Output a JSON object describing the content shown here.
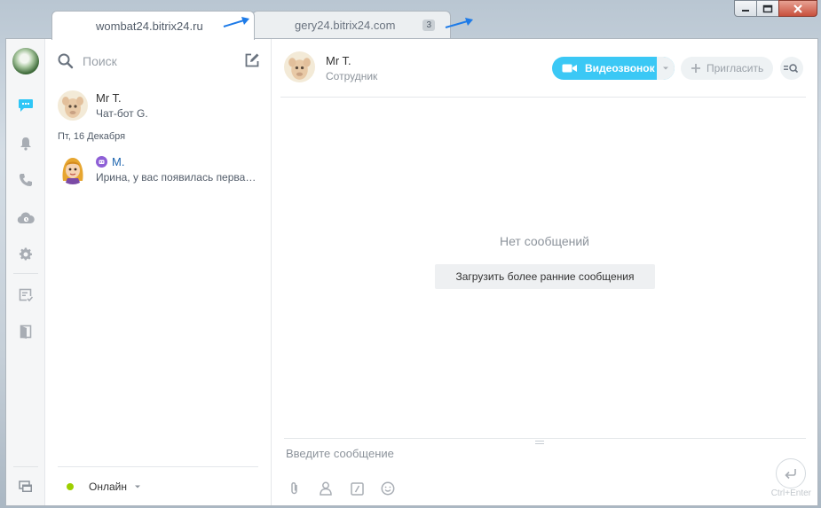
{
  "tabs": [
    {
      "label": "wombat24.bitrix24.ru",
      "count": ""
    },
    {
      "label": "gery24.bitrix24.com",
      "count": "3"
    }
  ],
  "search": {
    "placeholder": "Поиск"
  },
  "recent": {
    "items": [
      {
        "name": "Mr T.",
        "sub": "Чат-бот G."
      },
      {
        "name": "M.",
        "sub": "Ирина, у вас появилась первая задача!"
      }
    ],
    "date_header": "Пт, 16 Декабря"
  },
  "status": {
    "label": "Онлайн",
    "color": "#9dcf00"
  },
  "chat": {
    "name": "Mr T.",
    "position": "Сотрудник",
    "video_label": "Видеозвонок",
    "invite_label": "Пригласить",
    "empty_text": "Нет сообщений",
    "load_label": "Загрузить более ранние сообщения",
    "input_placeholder": "Введите сообщение",
    "send_hint": "Ctrl+Enter"
  },
  "colors": {
    "accent": "#3bc8f5",
    "arrow": "#1e7be8"
  },
  "icons": [
    "chat-icon",
    "bell-icon",
    "phone-icon",
    "cloud-icon",
    "gear-icon",
    "tasks-icon",
    "door-icon",
    "windows-icon"
  ]
}
